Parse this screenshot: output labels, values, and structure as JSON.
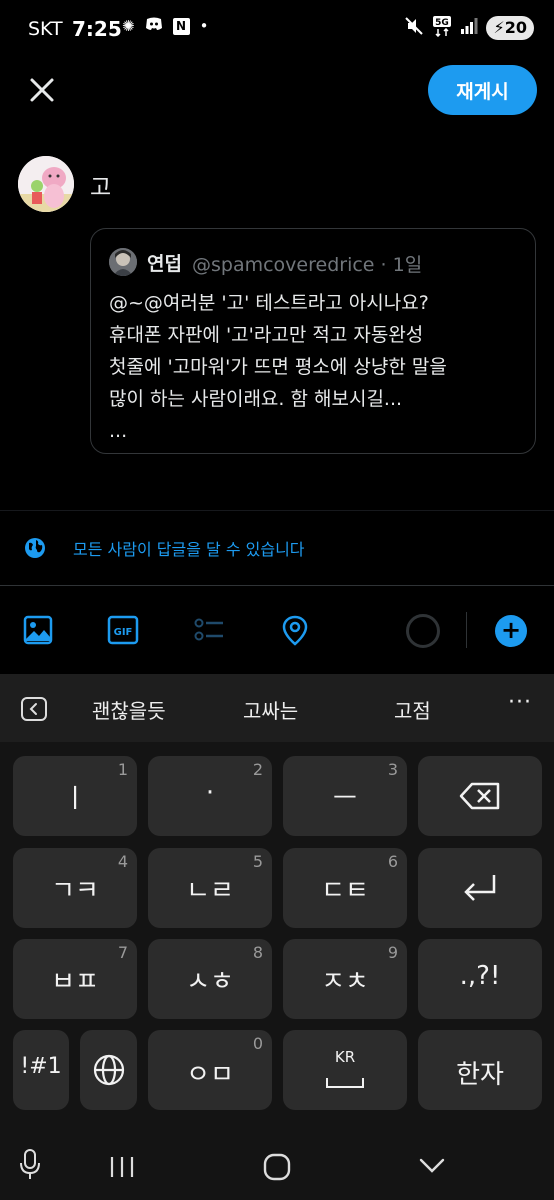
{
  "status_bar": {
    "carrier": "SKT",
    "time": "7:25",
    "battery": "20",
    "notification_icons": [
      "brightness-icon",
      "discord-icon",
      "naver-icon",
      "dot-icon"
    ],
    "naver_letter": "N"
  },
  "header": {
    "repost_label": "재게시"
  },
  "compose": {
    "text": "고"
  },
  "quote": {
    "author_name": "연덥",
    "author_handle": "@spamcoveredrice · 1일",
    "lines": [
      "@~@여러분 '고' 테스트라고 아시나요?",
      "휴대폰 자판에 '고'라고만 적고 자동완성",
      "첫줄에 '고마워'가 뜨면 평소에 상냥한 말을",
      "많이 하는 사람이래요. 함 해보시길...",
      "..."
    ]
  },
  "reply_setting": {
    "label": "모든 사람이 답글을 달 수 있습니다"
  },
  "toolbar": {
    "gif_label": "GIF",
    "add_symbol": "+"
  },
  "keyboard": {
    "suggestions": [
      "괜찮을듯",
      "고싸는",
      "고점"
    ],
    "more": "···",
    "rows": [
      [
        {
          "label": "ㅣ",
          "num": "1"
        },
        {
          "label": "·",
          "num": "2"
        },
        {
          "label": "ㅡ",
          "num": "3"
        }
      ],
      [
        {
          "label": "ㄱㅋ",
          "num": "4"
        },
        {
          "label": "ㄴㄹ",
          "num": "5"
        },
        {
          "label": "ㄷㅌ",
          "num": "6"
        }
      ],
      [
        {
          "label": "ㅂㅍ",
          "num": "7"
        },
        {
          "label": "ㅅㅎ",
          "num": "8"
        },
        {
          "label": "ㅈㅊ",
          "num": "9"
        }
      ]
    ],
    "punct_label": ".,?!",
    "symbols_label": "!#1",
    "zero_key": {
      "label": "ㅇㅁ",
      "num": "0"
    },
    "space_label": "KR",
    "hanja_label": "한자"
  },
  "colors": {
    "accent": "#1d9bf0",
    "background": "#000000",
    "keyboard_bg": "#141414",
    "key_bg": "#2c2c2c"
  }
}
